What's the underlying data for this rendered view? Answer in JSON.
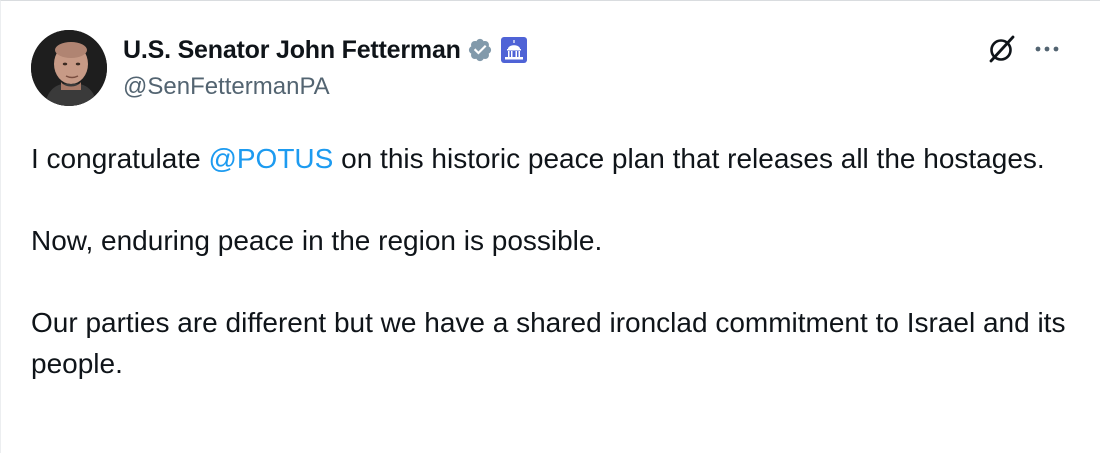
{
  "author": {
    "display_name": "U.S. Senator John Fetterman",
    "handle": "@SenFettermanPA",
    "verified_icon": "verified-badge-icon",
    "government_icon": "capitol-building-icon",
    "badge_color": "#829aab",
    "gov_badge_color": "#4f63d6"
  },
  "actions": {
    "grok_icon": "grok-icon",
    "more_icon": "more-options-icon"
  },
  "tweet": {
    "paragraph1": {
      "before": "I congratulate ",
      "mention": "@POTUS",
      "after": " on this historic peace plan that releases all the hostages."
    },
    "paragraph2": "Now, enduring peace in the region is possible.",
    "paragraph3": "Our parties are different but we have a shared ironclad commitment to Israel and its people.",
    "mention_color": "#1d9bf0"
  }
}
